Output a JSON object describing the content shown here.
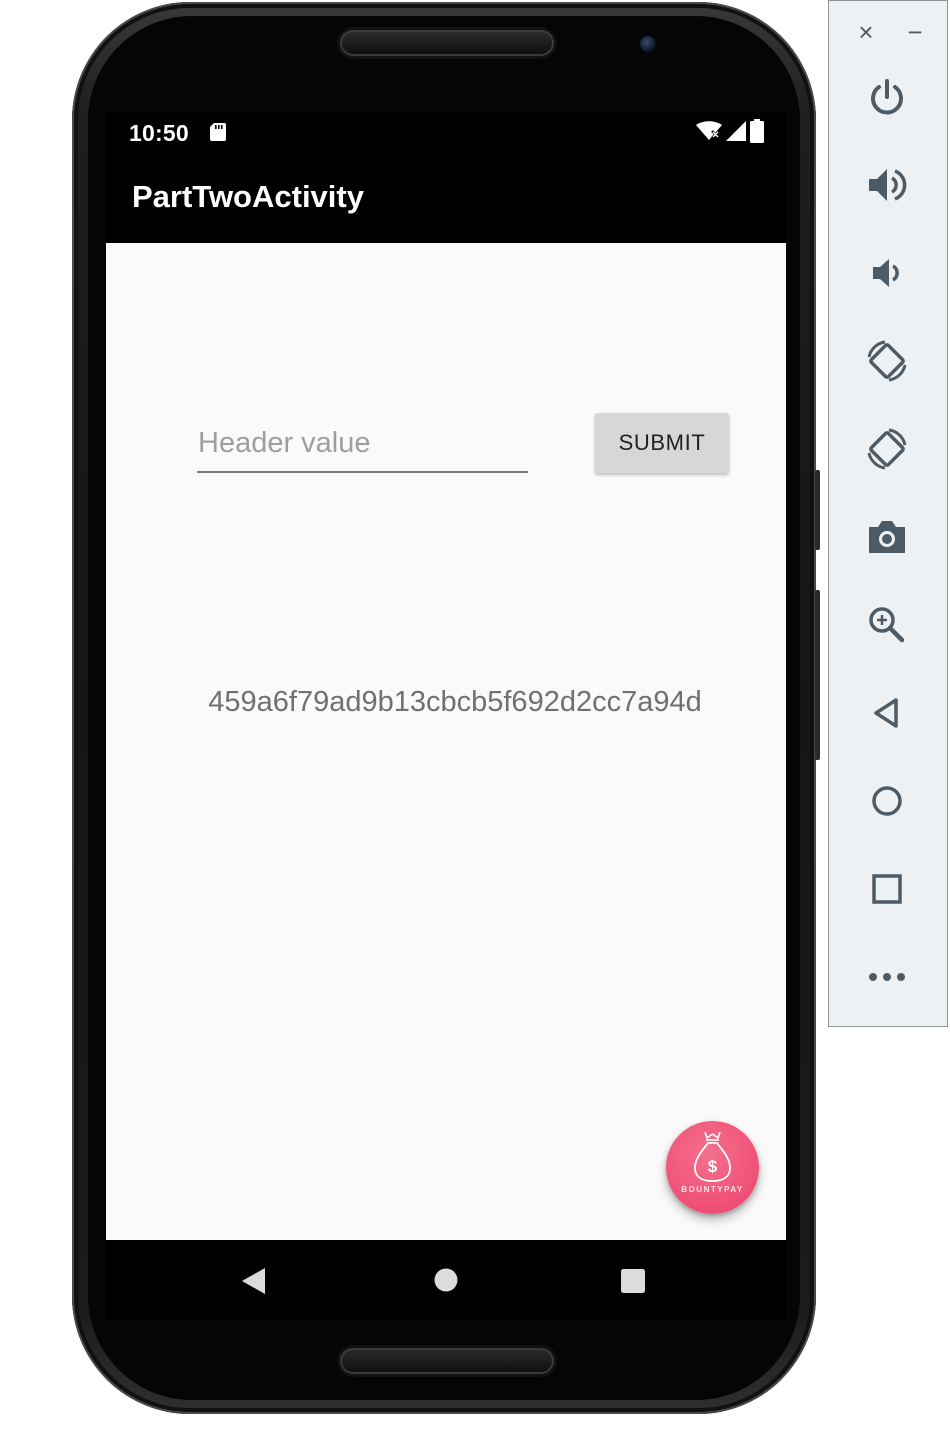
{
  "status_bar": {
    "time": "10:50"
  },
  "app_bar": {
    "title": "PartTwoActivity"
  },
  "form": {
    "header_input": {
      "placeholder": "Header value",
      "value": ""
    },
    "submit_label": "SUBMIT"
  },
  "result_text": "459a6f79ad9b13cbcb5f692d2cc7a94d",
  "fab": {
    "label": "BOUNTYPAY",
    "icon": "money-bag-icon",
    "color": "#ef4f76"
  },
  "nav_bar": {
    "icons": [
      "back-icon",
      "home-icon",
      "recents-icon"
    ]
  },
  "emulator_toolbar": {
    "window_controls": {
      "close": "×",
      "minimize": "−"
    },
    "buttons": [
      "power-icon",
      "volume-up-icon",
      "volume-down-icon",
      "rotate-left-icon",
      "rotate-right-icon",
      "camera-icon",
      "zoom-icon",
      "back-icon",
      "home-icon",
      "overview-icon",
      "more-icon"
    ]
  },
  "colors": {
    "app_bar": "#000000",
    "content_bg": "#fafafa",
    "button_bg": "#d6d7d7",
    "toolbar_icon": "#4d5b66"
  }
}
